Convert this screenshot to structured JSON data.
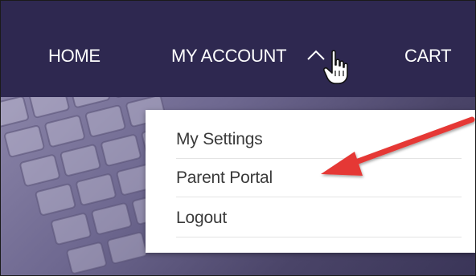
{
  "nav": {
    "items": [
      {
        "label": "HOME"
      },
      {
        "label": "MY ACCOUNT"
      },
      {
        "label": "CART"
      }
    ]
  },
  "dropdown": {
    "items": [
      {
        "label": "My Settings"
      },
      {
        "label": "Parent Portal"
      },
      {
        "label": "Logout"
      }
    ]
  },
  "icons": {
    "chevron": "chevron-up-icon",
    "cursor": "hand-pointer-icon",
    "annotation": "red-arrow-icon"
  },
  "colors": {
    "nav_bg": "#2e2850",
    "nav_text": "#ffffff",
    "dropdown_bg": "#ffffff",
    "dropdown_text": "#3a3a3a",
    "arrow": "#e53935"
  }
}
